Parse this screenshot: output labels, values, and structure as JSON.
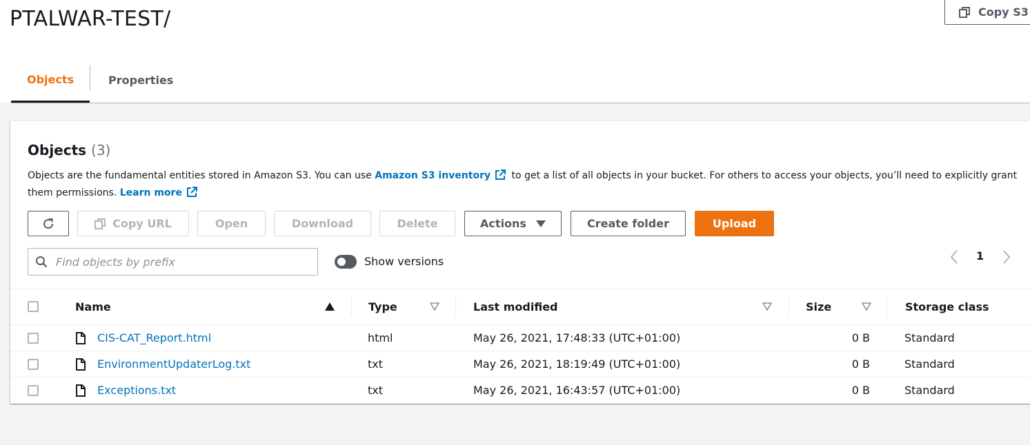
{
  "header": {
    "bucket_title": "PTALWAR-TEST/",
    "copy_s3_label": "Copy S3"
  },
  "tabs": [
    {
      "label": "Objects",
      "active": true
    },
    {
      "label": "Properties",
      "active": false
    }
  ],
  "objects_panel": {
    "title": "Objects",
    "count": "(3)",
    "desc_part1": "Objects are the fundamental entities stored in Amazon S3. You can use ",
    "desc_link1": "Amazon S3 inventory",
    "desc_part2": " to get a list of all objects in your bucket. For others to access your objects, you’ll need to explicitly grant them permissions. ",
    "desc_link2": "Learn more"
  },
  "toolbar": {
    "copy_url": "Copy URL",
    "open": "Open",
    "download": "Download",
    "delete": "Delete",
    "actions": "Actions",
    "create_folder": "Create folder",
    "upload": "Upload"
  },
  "search": {
    "placeholder": "Find objects by prefix",
    "value": ""
  },
  "versions_toggle": {
    "label": "Show versions",
    "on": false
  },
  "pagination": {
    "current_page": "1"
  },
  "table": {
    "columns": [
      "Name",
      "Type",
      "Last modified",
      "Size",
      "Storage class"
    ],
    "rows": [
      {
        "name": "CIS-CAT_Report.html",
        "type": "html",
        "modified": "May 26, 2021, 17:48:33 (UTC+01:00)",
        "size": "0 B",
        "storage": "Standard"
      },
      {
        "name": "EnvironmentUpdaterLog.txt",
        "type": "txt",
        "modified": "May 26, 2021, 18:19:49 (UTC+01:00)",
        "size": "0 B",
        "storage": "Standard"
      },
      {
        "name": "Exceptions.txt",
        "type": "txt",
        "modified": "May 26, 2021, 16:43:57 (UTC+01:00)",
        "size": "0 B",
        "storage": "Standard"
      }
    ]
  },
  "colors": {
    "accent": "#ec7211",
    "link": "#0073bb",
    "text": "#16191f",
    "muted": "#545b64",
    "disabled": "#aab7b8"
  }
}
